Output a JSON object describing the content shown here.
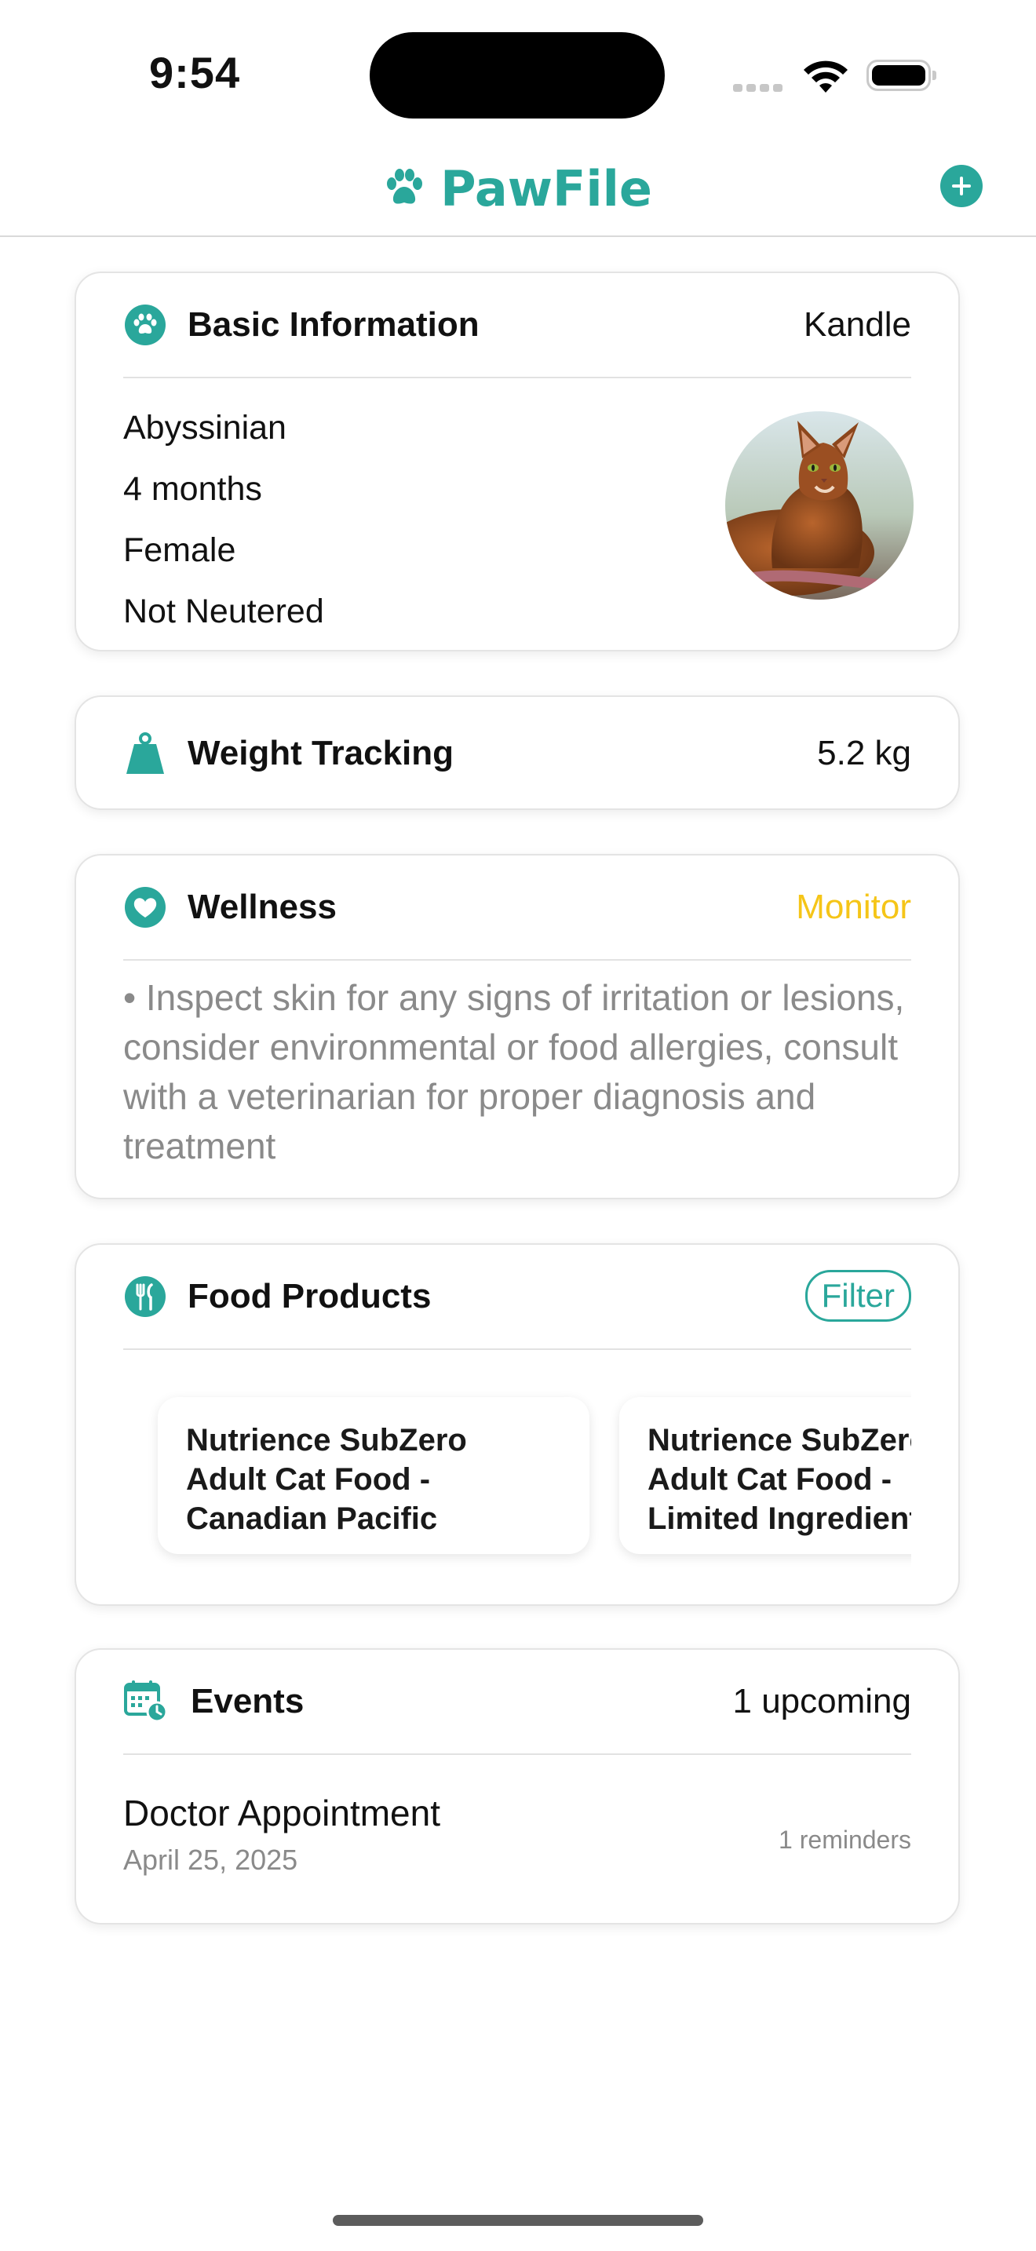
{
  "status_bar": {
    "time": "9:54"
  },
  "header": {
    "app_title": "PawFile",
    "logo_icon": "paw-icon",
    "add_icon": "plus-circle-icon",
    "accent_color": "#2aa79b"
  },
  "basic_info": {
    "title": "Basic Information",
    "icon": "paw-icon",
    "pet_name": "Kandle",
    "details": [
      "Abyssinian",
      "4 months",
      "Female",
      "Not Neutered"
    ]
  },
  "weight": {
    "title": "Weight Tracking",
    "icon": "weight-icon",
    "value": "5.2 kg"
  },
  "wellness": {
    "title": "Wellness",
    "icon": "heart-icon",
    "status": "Monitor",
    "status_color": "#f5c518",
    "note": "• Inspect skin for any signs of irritation or lesions, consider environmental or food allergies, consult with a veterinarian for proper diagnosis and treatment"
  },
  "food": {
    "title": "Food Products",
    "icon": "utensils-icon",
    "filter_label": "Filter",
    "products": [
      {
        "lines": [
          "Nutrience SubZero",
          "Adult Cat Food -",
          "Canadian Pacific"
        ]
      },
      {
        "lines": [
          "Nutrience SubZero",
          "Adult Cat Food -",
          "Limited Ingredient"
        ]
      }
    ]
  },
  "events": {
    "title": "Events",
    "icon": "calendar-clock-icon",
    "summary": "1 upcoming",
    "items": [
      {
        "name": "Doctor Appointment",
        "date": "April 25, 2025",
        "reminders": "1 reminders"
      }
    ]
  }
}
